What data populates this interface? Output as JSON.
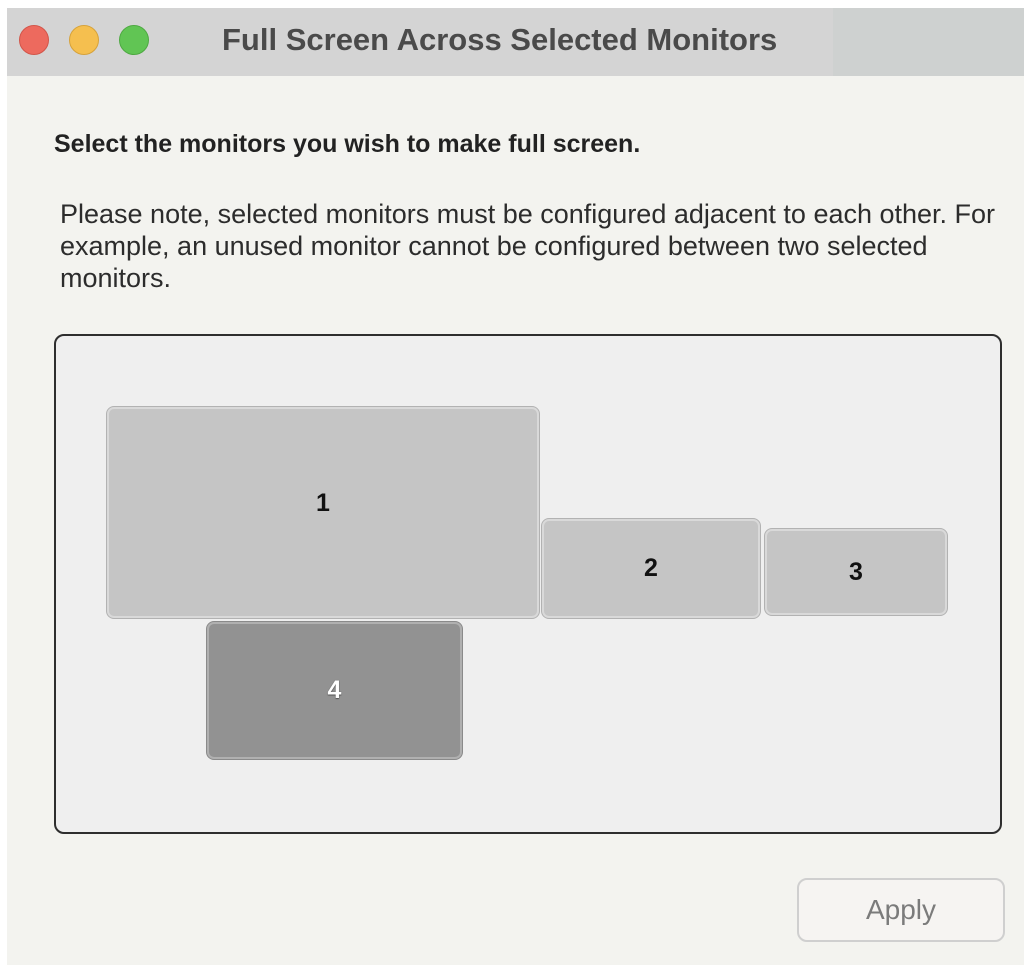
{
  "window": {
    "title": "Full Screen Across Selected Monitors",
    "traffic_lights": {
      "close": "#ed6a5e",
      "minimize": "#f5bf4f",
      "zoom": "#61c554"
    }
  },
  "content": {
    "heading": "Select the monitors you wish to make full screen.",
    "note": "Please note, selected monitors must be configured adjacent to each other. For example, an unused monitor cannot be configured between two selected monitors."
  },
  "monitors": [
    {
      "label": "1",
      "selected": false
    },
    {
      "label": "2",
      "selected": false
    },
    {
      "label": "3",
      "selected": false
    },
    {
      "label": "4",
      "selected": true
    }
  ],
  "buttons": {
    "apply_label": "Apply",
    "apply_enabled": false
  },
  "colors": {
    "window_background": "#f3f3ef",
    "monitor_unselected": "#c5c5c5",
    "monitor_selected": "#929292"
  }
}
